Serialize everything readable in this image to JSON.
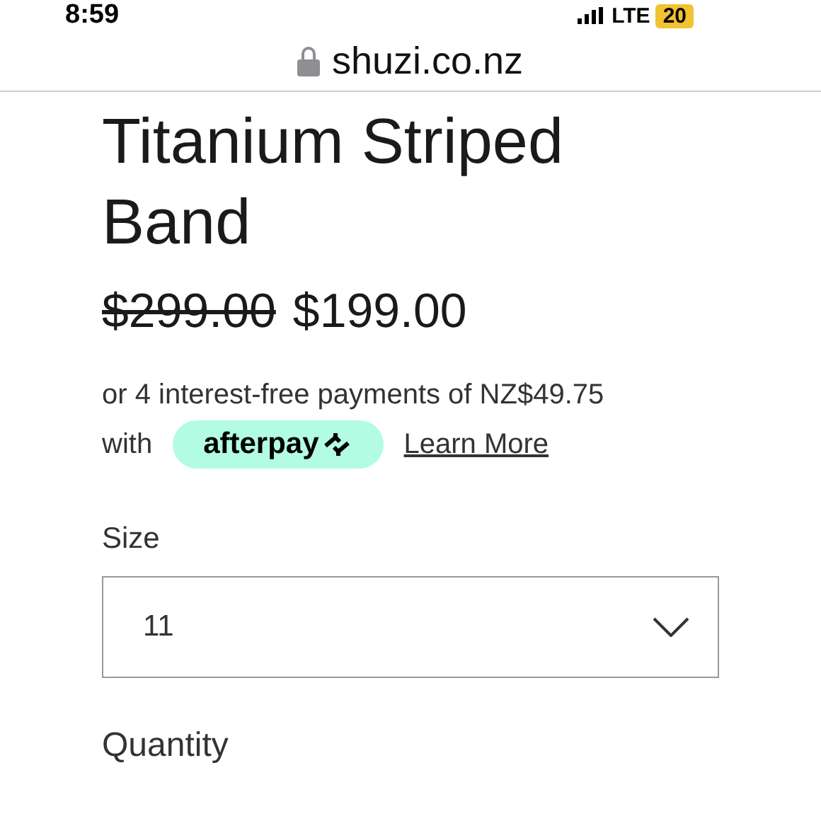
{
  "status_bar": {
    "time": "8:59",
    "network": "LTE",
    "battery": "20"
  },
  "address_bar": {
    "url": "shuzi.co.nz"
  },
  "product": {
    "title": "Titanium Striped Band",
    "old_price": "$299.00",
    "price": "$199.00",
    "installments": "or 4 interest-free payments of NZ$49.75",
    "with": "with",
    "afterpay_logo": "afterpay",
    "learn_more": "Learn More",
    "size_label": "Size",
    "size_value": "11",
    "quantity_label": "Quantity"
  }
}
